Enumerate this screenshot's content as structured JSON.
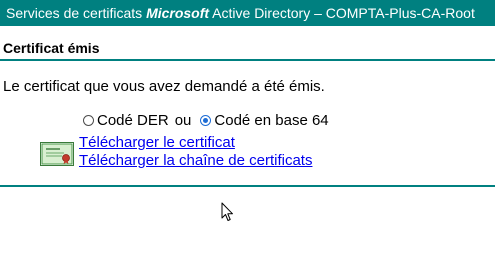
{
  "header": {
    "prefix": "Services de certificats ",
    "brand": "Microsoft",
    "suffix": " Active Directory  –  COMPTA-Plus-CA-Root"
  },
  "page": {
    "heading": "Certificat émis",
    "message": "Le certificat que vous avez demandé a été émis."
  },
  "encoding": {
    "options": [
      {
        "label": "Codé DER",
        "selected": false
      },
      {
        "label": "Codé en base 64",
        "selected": true
      }
    ],
    "separator": "ou"
  },
  "links": {
    "download_certificate": "Télécharger le certificat",
    "download_chain": "Télécharger la chaîne de certificats"
  },
  "icons": {
    "certificate": "certificate-icon",
    "cursor": "mouse-pointer"
  },
  "colors": {
    "accent": "#008080",
    "link": "#0000ee",
    "radio_selected": "#1e6dd5"
  }
}
